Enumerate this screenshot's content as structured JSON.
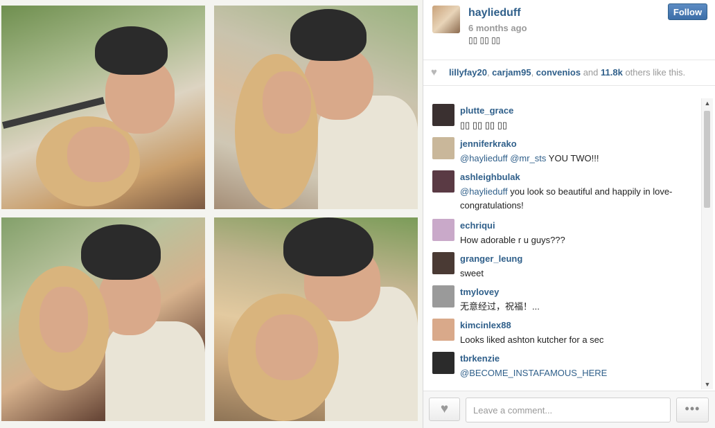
{
  "post": {
    "owner": "haylieduff",
    "time": "6 months ago",
    "caption": "▯▯ ▯▯ ▯▯",
    "follow_label": "Follow"
  },
  "likes": {
    "users": [
      "lillyfay20",
      "carjam95",
      "convenios"
    ],
    "sep1": ", ",
    "sep2": ", ",
    "and_text": " and ",
    "count": "11.8k",
    "suffix": " others like this."
  },
  "comments": [
    {
      "user": "plutte_grace",
      "text": "▯▯ ▯▯ ▯▯ ▯▯",
      "avatar_color": "#3a3030"
    },
    {
      "user": "jenniferkrako",
      "mention": "@haylieduff @mr_sts",
      "text": " YOU TWO!!!",
      "avatar_color": "#c9b79a"
    },
    {
      "user": "ashleighbulak",
      "mention": "@haylieduff",
      "text": " you look so beautiful and happily in love- congratulations!",
      "avatar_color": "#5a3a44"
    },
    {
      "user": "echriqui",
      "text": "How adorable r u guys???",
      "avatar_color": "#c9a9c9"
    },
    {
      "user": "granger_leung",
      "text": "sweet",
      "avatar_color": "#4a3a34"
    },
    {
      "user": "tmylovey",
      "text": "无意经过，祝福！...",
      "avatar_color": "#9a9a9a"
    },
    {
      "user": "kimcinlex88",
      "text": "Looks liked ashton kutcher for a sec",
      "avatar_color": "#d9a98a"
    },
    {
      "user": "tbrkenzie",
      "mention": "@BECOME_INSTAFAMOUS_HERE",
      "text": "",
      "avatar_color": "#2b2b2b"
    }
  ],
  "scroll": {
    "up_arrow": "▲",
    "down_arrow": "▼"
  },
  "footer": {
    "heart_glyph": "♥",
    "comment_placeholder": "Leave a comment...",
    "more_glyph": "•••"
  },
  "icons": {
    "likes_heart": "heart-icon",
    "like_button": "heart-icon",
    "more": "more-dots-icon"
  },
  "colors": {
    "link": "#2f5f8a",
    "follow_button": "#3c6ea8"
  }
}
